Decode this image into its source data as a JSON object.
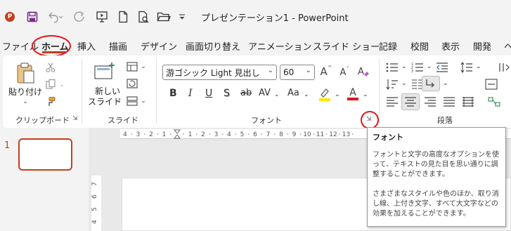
{
  "titlebar": {
    "app_icon": "P",
    "title": "プレゼンテーション1  -  PowerPoint",
    "quick_access": [
      "save-icon",
      "undo-icon",
      "redo-icon",
      "start-from-beginning-icon",
      "new-icon",
      "print-preview-icon",
      "open-icon",
      "customize-qat-icon"
    ]
  },
  "tabs": [
    {
      "label": "ファイル"
    },
    {
      "label": "ホーム",
      "active": true
    },
    {
      "label": "挿入"
    },
    {
      "label": "描画"
    },
    {
      "label": "デザイン"
    },
    {
      "label": "画面切り替え"
    },
    {
      "label": "アニメーション"
    },
    {
      "label": "スライド ショー"
    },
    {
      "label": "記録"
    },
    {
      "label": "校閲"
    },
    {
      "label": "表示"
    },
    {
      "label": "開発"
    },
    {
      "label": "ヘ"
    }
  ],
  "ribbon": {
    "clipboard": {
      "label": "クリップボード",
      "paste_label": "貼り付け"
    },
    "slides": {
      "label": "スライド",
      "new_slide_line1": "新しい",
      "new_slide_line2": "スライド"
    },
    "font": {
      "label": "フォント",
      "font_name": "游ゴシック Light 見出し",
      "font_size": "60",
      "bold": "B",
      "italic": "I",
      "underline": "U",
      "shadow": "S",
      "strike": "ab",
      "spacing": "AV",
      "case": "Aa",
      "color_letter": "A",
      "grow": "A",
      "shrink": "A",
      "highlight_color": "#ffe600",
      "font_color": "#e0181d"
    },
    "paragraph": {
      "label": "段落"
    }
  },
  "accent_color": "#c43e1c",
  "annotation_color": "#e0181d",
  "slides_pane": {
    "slide_number": "1"
  },
  "ruler": {
    "top_ticks": [
      "4",
      "3",
      "2",
      "1",
      "",
      "1",
      "2",
      "3",
      "4",
      "5",
      "6",
      "7",
      "8",
      "9",
      "10",
      "11",
      "12",
      "13"
    ],
    "left_ticks": [
      "7",
      "6",
      "5",
      "4"
    ]
  },
  "tooltip": {
    "title": "フォント",
    "body1": "フォントと文字の高度なオプションを使って、テキストの見た目を思い通りに調整することができます。",
    "body2": "さまざまなスタイルや色のほか、取り消し線、上付き文字、すべて大文字などの効果を加えることができます。"
  }
}
